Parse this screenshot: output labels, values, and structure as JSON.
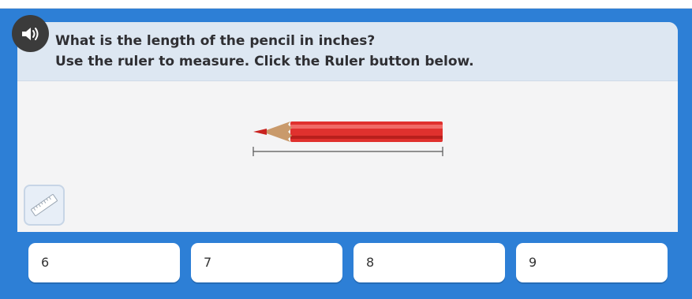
{
  "question": {
    "line1": "What is the length of the pencil in inches?",
    "line2": "Use the ruler to measure. Click the Ruler button below."
  },
  "icons": {
    "speaker": "speaker-icon",
    "ruler": "ruler-icon"
  },
  "answers": [
    {
      "label": "6"
    },
    {
      "label": "7"
    },
    {
      "label": "8"
    },
    {
      "label": "9"
    }
  ],
  "colors": {
    "background": "#2d7fd6",
    "question_bg": "#dde7f2",
    "pencil_body": "#e53935"
  }
}
